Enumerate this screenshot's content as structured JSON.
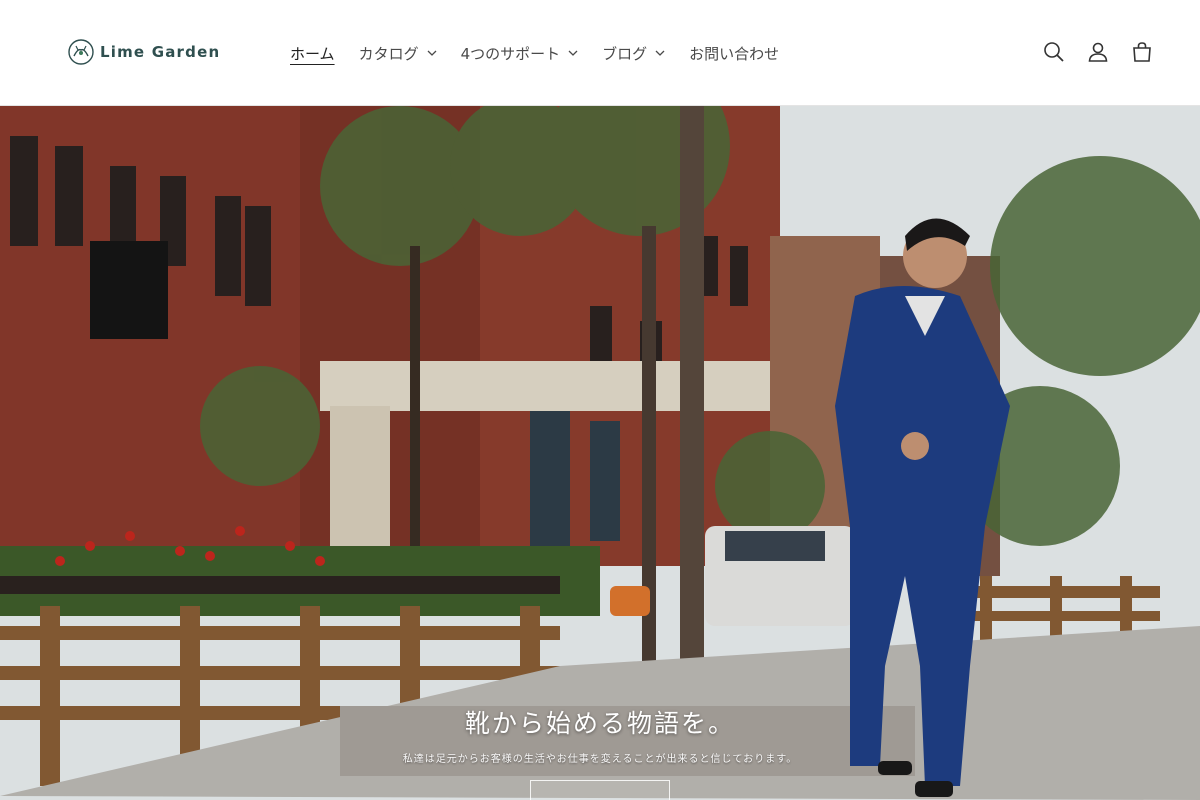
{
  "brand": {
    "name": "Lime Garden",
    "logo_icon": "deer-emblem-icon"
  },
  "nav": {
    "items": [
      {
        "label": "ホーム",
        "active": true,
        "has_dropdown": false
      },
      {
        "label": "カタログ",
        "active": false,
        "has_dropdown": true
      },
      {
        "label": "4つのサポート",
        "active": false,
        "has_dropdown": true
      },
      {
        "label": "ブログ",
        "active": false,
        "has_dropdown": true
      },
      {
        "label": "お問い合わせ",
        "active": false,
        "has_dropdown": false
      }
    ]
  },
  "header_icons": [
    "search-icon",
    "account-icon",
    "cart-icon"
  ],
  "hero": {
    "title": "靴から始める物語を。",
    "subtitle": "私達は足元からお客様の生活やお仕事を変えることが出来ると信じております。",
    "button_label": "",
    "image_description_icon": "street-scene-image"
  },
  "colors": {
    "brand_text": "#2f4f4f",
    "nav_text": "#4a4a4a",
    "suit_blue": "#1f3f86",
    "brick": "#8a3a2c"
  }
}
